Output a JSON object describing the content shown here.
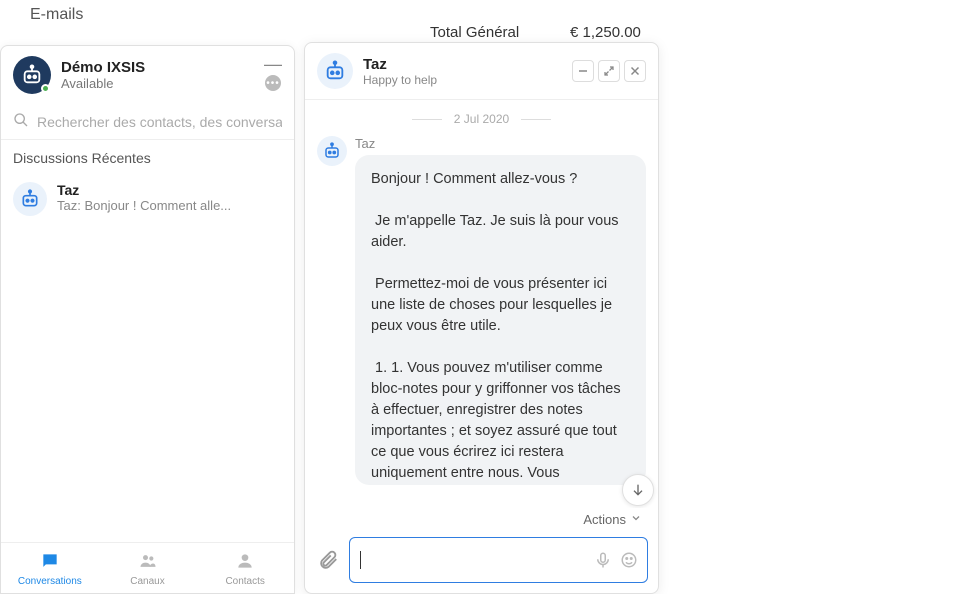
{
  "background": {
    "emails_label": "E-mails",
    "total_label": "Total Général",
    "total_value": "€ 1,250.00"
  },
  "sidebar": {
    "profile_name": "Démo IXSIS",
    "profile_status": "Available",
    "search_placeholder": "Rechercher des contacts, des conversations",
    "section_title": "Discussions Récentes",
    "conversations": [
      {
        "name": "Taz",
        "preview": "Taz: Bonjour ! Comment alle..."
      }
    ],
    "nav": {
      "conversations": "Conversations",
      "channels": "Canaux",
      "contacts": "Contacts"
    }
  },
  "chat": {
    "title": "Taz",
    "subtitle": "Happy to help",
    "date": "2 Jul 2020",
    "sender": "Taz",
    "message": "Bonjour ! Comment allez-vous ?\n\n Je m'appelle Taz. Je suis là pour vous aider.\n\n Permettez-moi de vous présenter ici une liste de choses pour lesquelles je peux vous être utile.\n\n 1. 1. Vous pouvez m'utiliser comme bloc-notes pour y griffonner vos tâches à effectuer, enregistrer des notes importantes ; et soyez assuré que tout ce que vous écrirez ici restera uniquement entre nous. Vous",
    "actions_label": "Actions",
    "input_value": ""
  },
  "icons": {
    "bot_glyph": "🤖",
    "search_glyph": "⌕",
    "dots_glyph": "•••"
  }
}
